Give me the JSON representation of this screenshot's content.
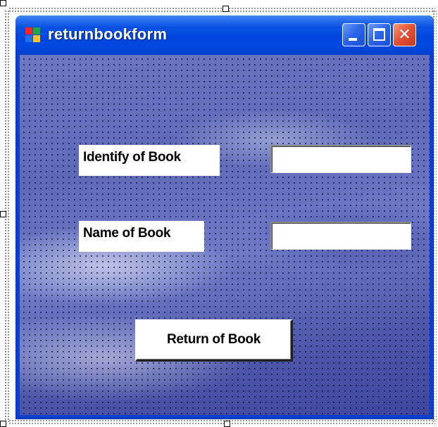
{
  "window": {
    "title": "returnbookform",
    "icon": "windows-form-icon",
    "controls": {
      "minimize_icon": "minimize-icon",
      "maximize_icon": "maximize-icon",
      "close_icon": "close-icon",
      "close_glyph": "✕"
    }
  },
  "form": {
    "identify_label": "Identify of Book",
    "identify_value": "",
    "name_label": "Name of Book",
    "name_value": "",
    "return_button": "Return of Book"
  },
  "colors": {
    "titlebar": "#0054e3",
    "close_button": "#e2553a",
    "client_background": "#5e6ab8"
  }
}
